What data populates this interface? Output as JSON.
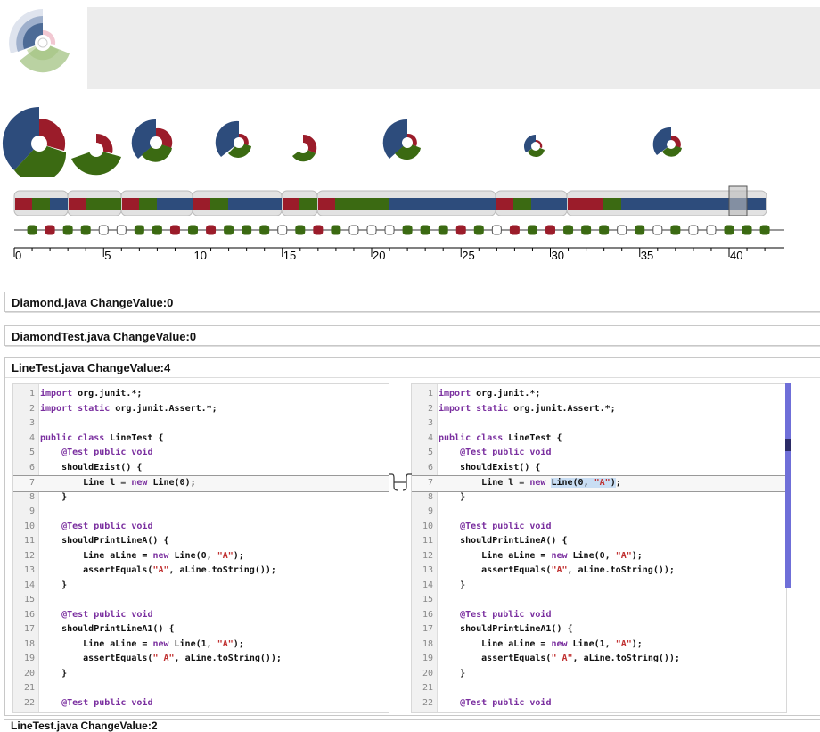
{
  "logo": {
    "icon": "radial-wedge-logo"
  },
  "colors": {
    "blue": "#2d4c7c",
    "red": "#9b1c2a",
    "green": "#3b6a12",
    "pink": "#f3c8cf",
    "gray": "#e8e8e8"
  },
  "glyphs": [
    {
      "size": "large"
    },
    {
      "size": "large"
    },
    {
      "size": "medium"
    },
    {
      "size": "medium"
    },
    {
      "size": "small"
    },
    {
      "size": "medium"
    },
    {
      "size": "small"
    },
    {
      "size": "small"
    }
  ],
  "timeline": {
    "ticks": [
      "0",
      "5",
      "10",
      "15",
      "20",
      "25",
      "30",
      "35",
      "40"
    ],
    "max": 42,
    "selected": 40
  },
  "panels": [
    {
      "title": "Diamond.java ChangeValue:0"
    },
    {
      "title": "DiamondTest.java ChangeValue:0"
    },
    {
      "title": "LineTest.java ChangeValue:4"
    }
  ],
  "diff": {
    "left": [
      {
        "n": "1",
        "text": "import org.junit.*;"
      },
      {
        "n": "2",
        "text": "import static org.junit.Assert.*;"
      },
      {
        "n": "3",
        "text": ""
      },
      {
        "n": "4",
        "text": "public class LineTest {"
      },
      {
        "n": "5",
        "text": "    @Test public void"
      },
      {
        "n": "6",
        "text": "    shouldExist() {"
      },
      {
        "n": "7",
        "text": "        Line l = new Line(0);"
      },
      {
        "n": "8",
        "text": "    }"
      },
      {
        "n": "9",
        "text": ""
      },
      {
        "n": "10",
        "text": "    @Test public void"
      },
      {
        "n": "11",
        "text": "    shouldPrintLineA() {"
      },
      {
        "n": "12",
        "text": "        Line aLine = new Line(0, \"A\");"
      },
      {
        "n": "13",
        "text": "        assertEquals(\"A\", aLine.toString());"
      },
      {
        "n": "14",
        "text": "    }"
      },
      {
        "n": "15",
        "text": ""
      },
      {
        "n": "16",
        "text": "    @Test public void"
      },
      {
        "n": "17",
        "text": "    shouldPrintLineA1() {"
      },
      {
        "n": "18",
        "text": "        Line aLine = new Line(1, \"A\");"
      },
      {
        "n": "19",
        "text": "        assertEquals(\" A\", aLine.toString());"
      },
      {
        "n": "20",
        "text": "    }"
      },
      {
        "n": "21",
        "text": ""
      },
      {
        "n": "22",
        "text": "    @Test public void"
      }
    ],
    "right": [
      {
        "n": "1",
        "text": "import org.junit.*;"
      },
      {
        "n": "2",
        "text": "import static org.junit.Assert.*;"
      },
      {
        "n": "3",
        "text": ""
      },
      {
        "n": "4",
        "text": "public class LineTest {"
      },
      {
        "n": "5",
        "text": "    @Test public void"
      },
      {
        "n": "6",
        "text": "    shouldExist() {"
      },
      {
        "n": "7",
        "text": "        Line l = new Line(0, \"A\");"
      },
      {
        "n": "8",
        "text": "    }"
      },
      {
        "n": "9",
        "text": ""
      },
      {
        "n": "10",
        "text": "    @Test public void"
      },
      {
        "n": "11",
        "text": "    shouldPrintLineA() {"
      },
      {
        "n": "12",
        "text": "        Line aLine = new Line(0, \"A\");"
      },
      {
        "n": "13",
        "text": "        assertEquals(\"A\", aLine.toString());"
      },
      {
        "n": "14",
        "text": "    }"
      },
      {
        "n": "15",
        "text": ""
      },
      {
        "n": "16",
        "text": "    @Test public void"
      },
      {
        "n": "17",
        "text": "    shouldPrintLineA1() {"
      },
      {
        "n": "18",
        "text": "        Line aLine = new Line(1, \"A\");"
      },
      {
        "n": "19",
        "text": "        assertEquals(\" A\", aLine.toString());"
      },
      {
        "n": "20",
        "text": "    }"
      },
      {
        "n": "21",
        "text": ""
      },
      {
        "n": "22",
        "text": "    @Test public void"
      }
    ],
    "changed_line": "7",
    "left_deleted": "Line(0);",
    "right_inserted": "Line(0, \"A\");"
  },
  "bottom_panel": {
    "title": "LineTest.java ChangeValue:2"
  }
}
